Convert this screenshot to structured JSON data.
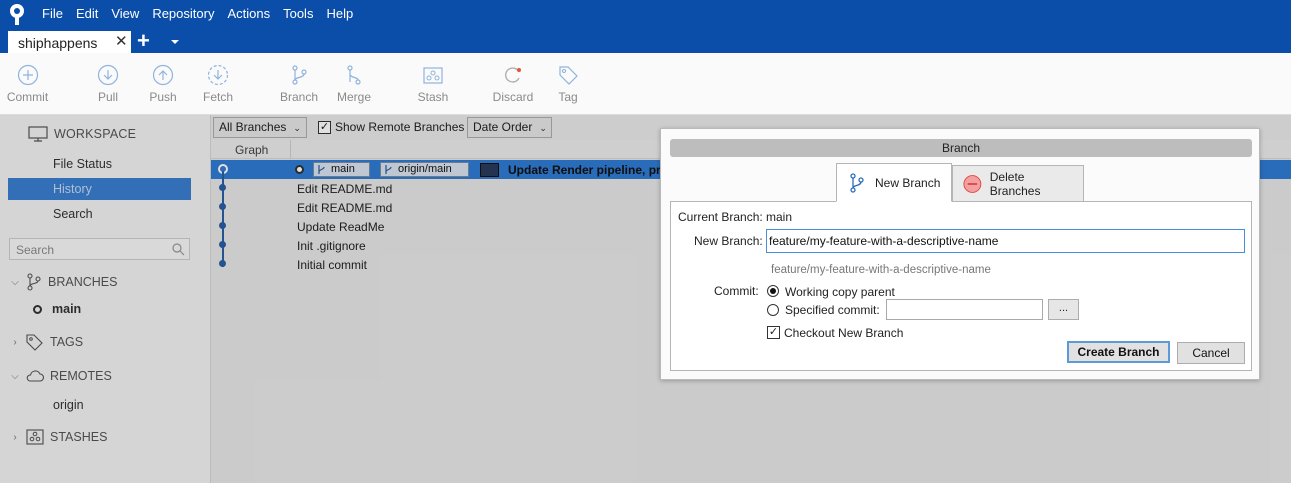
{
  "menu": [
    "File",
    "Edit",
    "View",
    "Repository",
    "Actions",
    "Tools",
    "Help"
  ],
  "tab": {
    "label": "shiphappens",
    "close": "✕",
    "add": "+"
  },
  "toolbar": {
    "commit": "Commit",
    "pull": "Pull",
    "push": "Push",
    "fetch": "Fetch",
    "branch": "Branch",
    "merge": "Merge",
    "stash": "Stash",
    "discard": "Discard",
    "tag": "Tag"
  },
  "sidebar": {
    "workspace": "WORKSPACE",
    "file_status": "File Status",
    "history": "History",
    "search": "Search",
    "search_placeholder": "Search",
    "branches": "BRANCHES",
    "branch_main": "main",
    "tags": "TAGS",
    "remotes": "REMOTES",
    "remote_origin": "origin",
    "stashes": "STASHES"
  },
  "filters": {
    "branches_select": "All Branches",
    "show_remote": "Show Remote Branches",
    "order_select": "Date Order",
    "graph_header": "Graph"
  },
  "commits": [
    {
      "message": "Update Render pipeline, pr",
      "refs": [
        "main",
        "origin/main"
      ]
    },
    {
      "message": "Edit README.md"
    },
    {
      "message": "Edit README.md"
    },
    {
      "message": "Update ReadMe"
    },
    {
      "message": "Init .gitignore"
    },
    {
      "message": "Initial commit"
    }
  ],
  "dialog": {
    "title": "Branch",
    "tab_new": "New Branch",
    "tab_delete": "Delete Branches",
    "current_branch_label": "Current Branch:",
    "current_branch_value": "main",
    "new_branch_label": "New Branch:",
    "new_branch_value": "feature/my-feature-with-a-descriptive-name",
    "new_branch_hint": "feature/my-feature-with-a-descriptive-name",
    "commit_label": "Commit:",
    "option_working_copy": "Working copy parent",
    "option_specified": "Specified commit:",
    "browse": "...",
    "checkout_label": "Checkout New Branch",
    "create_button": "Create Branch",
    "cancel_button": "Cancel"
  }
}
